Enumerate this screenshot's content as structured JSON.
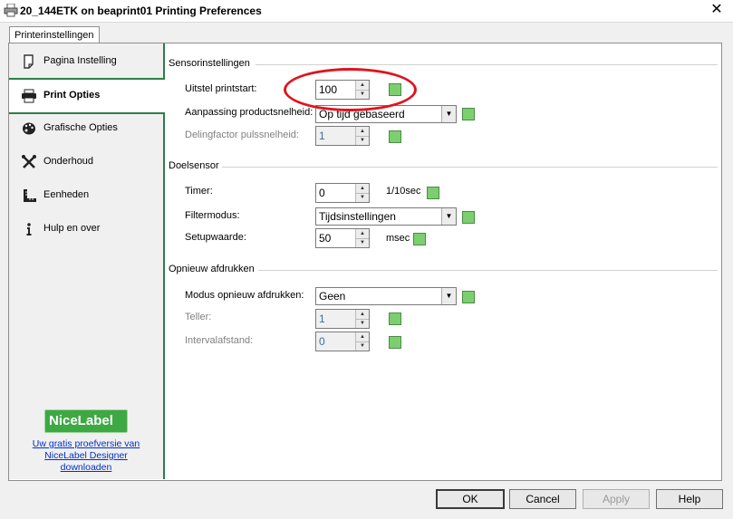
{
  "window": {
    "title": "20_144ETK on beaprint01 Printing Preferences",
    "close_glyph": "✕"
  },
  "tab": {
    "label": "Printerinstellingen"
  },
  "sidebar": {
    "items": [
      {
        "label": "Pagina Instelling",
        "icon": "page-icon"
      },
      {
        "label": "Print Opties",
        "icon": "printer-icon",
        "active": true
      },
      {
        "label": "Grafische Opties",
        "icon": "palette-icon"
      },
      {
        "label": "Onderhoud",
        "icon": "tools-icon"
      },
      {
        "label": "Eenheden",
        "icon": "ruler-icon"
      },
      {
        "label": "Hulp en over",
        "icon": "info-icon"
      }
    ],
    "logo_text": "NiceLabel",
    "promo_link": "Uw gratis proefversie van NiceLabel Designer downloaden"
  },
  "groups": {
    "sensor": {
      "header": "Sensorinstellingen",
      "delay_label": "Uitstel printstart:",
      "delay_value": "100",
      "speed_label": "Aanpassing productsnelheid:",
      "speed_value": "Op tijd gebaseerd",
      "divider_label": "Delingfactor pulssnelheid:",
      "divider_value": "1"
    },
    "target": {
      "header": "Doelsensor",
      "timer_label": "Timer:",
      "timer_value": "0",
      "timer_unit": "1/10sec",
      "filter_label": "Filtermodus:",
      "filter_value": "Tijdsinstellingen",
      "setup_label": "Setupwaarde:",
      "setup_value": "50",
      "setup_unit": "msec"
    },
    "reprint": {
      "header": "Opnieuw afdrukken",
      "mode_label": "Modus opnieuw afdrukken:",
      "mode_value": "Geen",
      "counter_label": "Teller:",
      "counter_value": "1",
      "interval_label": "Intervalafstand:",
      "interval_value": "0"
    }
  },
  "buttons": {
    "ok": "OK",
    "cancel": "Cancel",
    "apply": "Apply",
    "help": "Help"
  },
  "colors": {
    "accent_green": "#2e7d4a",
    "annotation_red": "#e0141e",
    "indicator_green": "#7ccf6e"
  }
}
